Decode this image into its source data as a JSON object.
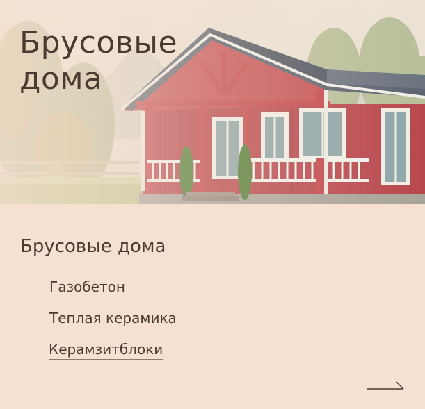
{
  "hero": {
    "title_line1": "Брусовые",
    "title_line2": "дома"
  },
  "section": {
    "title": "Брусовые дома"
  },
  "links": [
    {
      "label": "Газобетон"
    },
    {
      "label": "Теплая керамика"
    },
    {
      "label": "Керамзитблоки"
    }
  ],
  "icons": {
    "next": "arrow-right-icon"
  },
  "colors": {
    "background": "#f6e1d1",
    "text": "#4a3a32",
    "house_wall": "#b8474d",
    "roof": "#5b6470"
  }
}
